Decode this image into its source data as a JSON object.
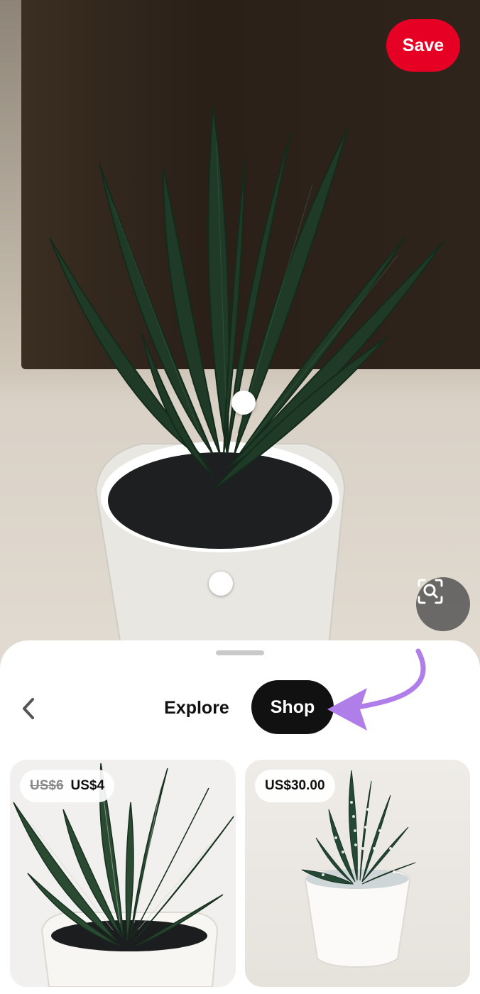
{
  "hero": {
    "save_label": "Save",
    "lens_icon": "visual-search-icon"
  },
  "sheet": {
    "back_icon": "chevron-left-icon",
    "tabs": [
      {
        "label": "Explore",
        "selected": false
      },
      {
        "label": "Shop",
        "selected": true
      }
    ],
    "annotation_color": "#b07ee8"
  },
  "products": [
    {
      "old_price": "US$6",
      "price": "US$4"
    },
    {
      "price": "US$30.00"
    }
  ],
  "colors": {
    "save_red": "#e60023",
    "tab_selected_bg": "#111111"
  }
}
